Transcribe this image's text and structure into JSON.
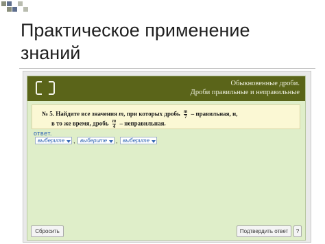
{
  "slide": {
    "title_line1": "Практическое применение",
    "title_line2": "знаний"
  },
  "app": {
    "header": {
      "line1": "Обыкновенные дроби.",
      "line2": "Дроби правильные и неправильные"
    },
    "task": {
      "number": "№ 5.",
      "text_part1": "Найдите все значения",
      "var": "m",
      "text_part2": ", при которых дробь",
      "frac1_num": "m",
      "frac1_den": "7",
      "text_part3": "– правильная, и,",
      "text_part4": "в то же время, дробь",
      "frac2_num": "m",
      "frac2_den": "4",
      "text_part5": "– неправильная."
    },
    "answer_label": "ответ.",
    "selects": [
      {
        "value": "выберите"
      },
      {
        "value": "выберите"
      },
      {
        "value": "выберите"
      }
    ],
    "separator": ",",
    "buttons": {
      "reset": "Сбросить",
      "confirm": "Подтвердить ответ",
      "help": "?"
    }
  }
}
